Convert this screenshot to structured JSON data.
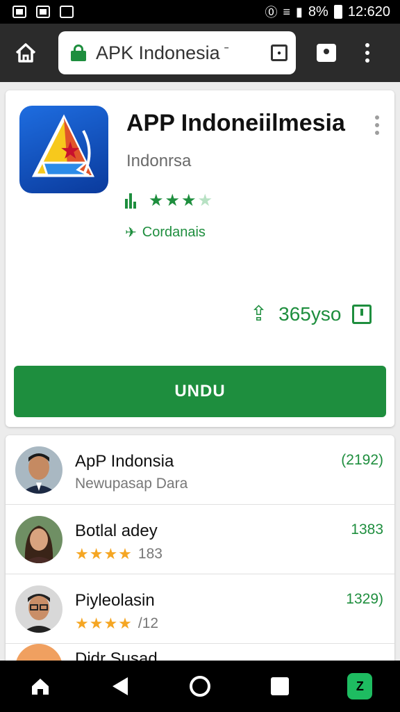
{
  "status_bar": {
    "battery": "8%",
    "time": "12:620",
    "nfc_glyph": "⓪",
    "wifi_glyph": "≡"
  },
  "browser": {
    "url_text": "APK Indonesia",
    "url_chevron": "ˉ"
  },
  "app": {
    "title": "APP Indoneiilmesia",
    "developer": "Indonrsa",
    "stars_filled": "★★★",
    "stars_empty": "★",
    "category": "Cordanais",
    "category_glyph": "✈",
    "size": "365yso",
    "share_glyph": "⇪",
    "download_label": "UNDU"
  },
  "list": [
    {
      "title": "ApP Indonsia",
      "subtitle": "Newupasap Dara",
      "count": "(2192)"
    },
    {
      "title": "Botlal adey",
      "stars": "★★★★",
      "rating_count": "183",
      "count": "1383"
    },
    {
      "title": "Piyleolasin",
      "stars": "★★★★",
      "rating_count": "/12",
      "count": "1329)"
    }
  ],
  "list_partial_title": "Didr Susad",
  "nav": {
    "app_glyph": "Z"
  },
  "colors": {
    "accent": "#1e8e3e",
    "star_orange": "#f5a623",
    "browser_bar": "#2b2b2b"
  }
}
